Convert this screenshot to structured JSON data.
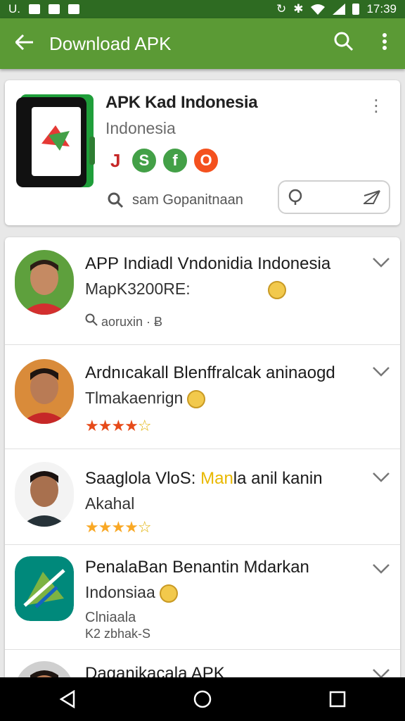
{
  "status_bar": {
    "left_text": "U.",
    "time": "17:39"
  },
  "app_bar": {
    "title": "Download APK",
    "icons": [
      "back-arrow-icon",
      "search-icon",
      "more-vert-icon"
    ]
  },
  "featured": {
    "name": "APK Kad Indonesia",
    "subtitle": "Indonesia",
    "badge_text": "J",
    "search_text": "sam Gopanitnaan",
    "colors": {
      "green": "#43a047",
      "orange": "#f4511e"
    }
  },
  "list": [
    {
      "title": "APP Indiadl Vndonidia Indonesia",
      "subtitle": "MapK3200RE:",
      "meta": "aoruxin · Ƀ"
    },
    {
      "title": "Ardnıcakall Blenffralcak aninaogd",
      "subtitle": "Tlmakaenrign",
      "rating": 3.5
    },
    {
      "title_a": "Saaglola VloS: ",
      "title_hl": "Man",
      "title_b": "la anil  kanin",
      "subtitle": "Akahal",
      "rating": 3.5
    },
    {
      "title": "PenalaBan Benantin Mdarkan",
      "subtitle": "Indonsiaa",
      "meta1": "Clniaala",
      "meta2": "K2 zbhak-S"
    },
    {
      "title": "Daganikacala APK"
    }
  ],
  "colors": {
    "status_bar": "#2e6b22",
    "app_bar": "#5b9a35",
    "star_orange": "#e64a19",
    "star_yellow": "#f9a825"
  }
}
